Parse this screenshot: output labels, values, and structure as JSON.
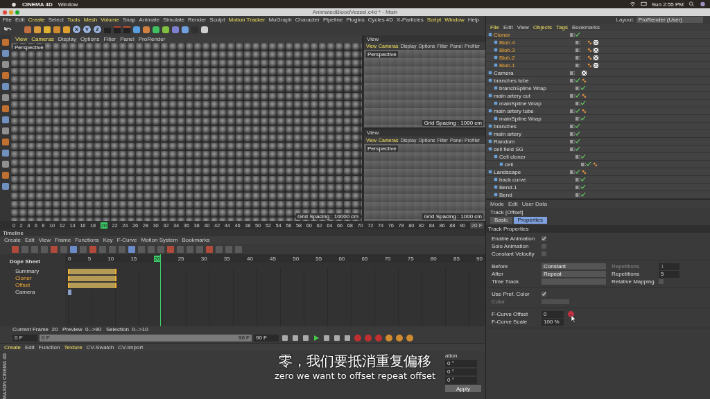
{
  "menubar": {
    "app": "CINEMA 4D",
    "menus": [
      "Window"
    ],
    "clock": "Sun 2:55 PM"
  },
  "window": {
    "title": "AnimatedBloodVessel.c4d * - Main"
  },
  "menu": [
    {
      "label": "File",
      "highlighted": false
    },
    {
      "label": "Edit",
      "highlighted": false
    },
    {
      "label": "Create",
      "highlighted": true
    },
    {
      "label": "Select",
      "highlighted": false
    },
    {
      "label": "Tools",
      "highlighted": true
    },
    {
      "label": "Mesh",
      "highlighted": true
    },
    {
      "label": "Volume",
      "highlighted": true
    },
    {
      "label": "Snap",
      "highlighted": false
    },
    {
      "label": "Animate",
      "highlighted": false
    },
    {
      "label": "Simulate",
      "highlighted": false
    },
    {
      "label": "Render",
      "highlighted": false
    },
    {
      "label": "Sculpt",
      "highlighted": false
    },
    {
      "label": "Motion Tracker",
      "highlighted": true
    },
    {
      "label": "MoGraph",
      "highlighted": false
    },
    {
      "label": "Character",
      "highlighted": false
    },
    {
      "label": "Pipeline",
      "highlighted": false
    },
    {
      "label": "Plugins",
      "highlighted": false
    },
    {
      "label": "Cycles 4D",
      "highlighted": false
    },
    {
      "label": "X-Particles",
      "highlighted": false
    },
    {
      "label": "Script",
      "highlighted": true
    },
    {
      "label": "Window",
      "highlighted": true
    },
    {
      "label": "Help",
      "highlighted": false
    }
  ],
  "layout": {
    "label": "Layout:",
    "value": "ProRender (User)"
  },
  "axis_buttons": [
    "X",
    "Y",
    "Z"
  ],
  "viewports": [
    {
      "menu": [
        {
          "label": "View",
          "highlighted": true
        },
        {
          "label": "Cameras",
          "highlighted": true
        },
        {
          "label": "Display",
          "highlighted": false
        },
        {
          "label": "Options",
          "highlighted": false
        },
        {
          "label": "Filter",
          "highlighted": false
        },
        {
          "label": "Panel",
          "highlighted": false
        },
        {
          "label": "ProRender",
          "highlighted": false
        }
      ],
      "camera": "Perspective",
      "grid": "Grid Spacing : 10000 cm"
    },
    {
      "header": "View",
      "menu": [
        {
          "label": "View",
          "highlighted": true
        },
        {
          "label": "Cameras",
          "highlighted": true
        },
        {
          "label": "Display",
          "highlighted": false
        },
        {
          "label": "Options",
          "highlighted": false
        },
        {
          "label": "Filter",
          "highlighted": false
        },
        {
          "label": "Panel",
          "highlighted": false
        },
        {
          "label": "Profiler",
          "highlighted": false
        }
      ],
      "camera": "Perspective",
      "grid": "Grid Spacing : 1000 cm"
    },
    {
      "header": "View",
      "menu": [
        {
          "label": "View",
          "highlighted": true
        },
        {
          "label": "Cameras",
          "highlighted": true
        },
        {
          "label": "Display",
          "highlighted": false
        },
        {
          "label": "Options",
          "highlighted": false
        },
        {
          "label": "Filter",
          "highlighted": false
        },
        {
          "label": "Panel",
          "highlighted": false
        },
        {
          "label": "Profiler",
          "highlighted": false
        }
      ],
      "camera": "Perspective",
      "grid": "Grid Spacing : 1000 cm"
    }
  ],
  "frame_ruler": {
    "ticks": [
      {
        "label": "0",
        "current": false
      },
      {
        "label": "2",
        "current": false
      },
      {
        "label": "4",
        "current": false
      },
      {
        "label": "6",
        "current": false
      },
      {
        "label": "8",
        "current": false
      },
      {
        "label": "10",
        "current": false
      },
      {
        "label": "12",
        "current": false
      },
      {
        "label": "14",
        "current": false
      },
      {
        "label": "16",
        "current": false
      },
      {
        "label": "18",
        "current": false
      },
      {
        "label": "20",
        "current": true
      },
      {
        "label": "22",
        "current": false
      },
      {
        "label": "24",
        "current": false
      },
      {
        "label": "26",
        "current": false
      },
      {
        "label": "28",
        "current": false
      },
      {
        "label": "30",
        "current": false
      },
      {
        "label": "32",
        "current": false
      },
      {
        "label": "34",
        "current": false
      },
      {
        "label": "36",
        "current": false
      },
      {
        "label": "38",
        "current": false
      },
      {
        "label": "40",
        "current": false
      },
      {
        "label": "42",
        "current": false
      },
      {
        "label": "44",
        "current": false
      },
      {
        "label": "46",
        "current": false
      },
      {
        "label": "48",
        "current": false
      },
      {
        "label": "50",
        "current": false
      },
      {
        "label": "52",
        "current": false
      },
      {
        "label": "54",
        "current": false
      },
      {
        "label": "56",
        "current": false
      },
      {
        "label": "58",
        "current": false
      },
      {
        "label": "60",
        "current": false
      },
      {
        "label": "62",
        "current": false
      },
      {
        "label": "64",
        "current": false
      },
      {
        "label": "66",
        "current": false
      },
      {
        "label": "68",
        "current": false
      },
      {
        "label": "70",
        "current": false
      },
      {
        "label": "72",
        "current": false
      },
      {
        "label": "74",
        "current": false
      },
      {
        "label": "76",
        "current": false
      },
      {
        "label": "78",
        "current": false
      },
      {
        "label": "80",
        "current": false
      },
      {
        "label": "82",
        "current": false
      },
      {
        "label": "84",
        "current": false
      },
      {
        "label": "86",
        "current": false
      },
      {
        "label": "88",
        "current": false
      },
      {
        "label": "90",
        "current": false
      }
    ],
    "end": "20 F"
  },
  "timeline": {
    "title": "Timeline",
    "menu": [
      "Create",
      "Edit",
      "View",
      "Frame",
      "Functions",
      "Key",
      "F-Curve",
      "Motion System",
      "Bookmarks"
    ],
    "mode": "Dope Sheet",
    "ticks": [
      {
        "label": "0",
        "current": false
      },
      {
        "label": "5",
        "current": false
      },
      {
        "label": "10",
        "current": false
      },
      {
        "label": "15",
        "current": false
      },
      {
        "label": "20",
        "current": true
      },
      {
        "label": "25",
        "current": false
      },
      {
        "label": "30",
        "current": false
      },
      {
        "label": "35",
        "current": false
      },
      {
        "label": "40",
        "current": false
      },
      {
        "label": "45",
        "current": false
      },
      {
        "label": "50",
        "current": false
      },
      {
        "label": "55",
        "current": false
      },
      {
        "label": "60",
        "current": false
      },
      {
        "label": "65",
        "current": false
      },
      {
        "label": "70",
        "current": false
      },
      {
        "label": "75",
        "current": false
      },
      {
        "label": "80",
        "current": false
      },
      {
        "label": "85",
        "current": false
      },
      {
        "label": "90",
        "current": false
      }
    ],
    "tracks": [
      {
        "name": "Summary",
        "selected": false,
        "kind": "range"
      },
      {
        "name": "Cloner",
        "selected": true,
        "kind": "range"
      },
      {
        "name": "Offset",
        "selected": true,
        "kind": "range"
      },
      {
        "name": "Camera",
        "selected": false,
        "kind": "single"
      }
    ],
    "status": "Current Frame  20   Preview  0-->90   Selection  0-->10",
    "start": "0 F",
    "slider": {
      "level": 1,
      "start": "0 F",
      "end": "90 F"
    },
    "end": "90 F"
  },
  "material_manager": {
    "menu": [
      {
        "label": "Create",
        "highlighted": true
      },
      {
        "label": "Edit",
        "highlighted": false
      },
      {
        "label": "Function",
        "highlighted": false
      },
      {
        "label": "Texture",
        "highlighted": true
      },
      {
        "label": "CV-Swatch",
        "highlighted": false
      },
      {
        "label": "CV-Import",
        "highlighted": false
      }
    ]
  },
  "coordinates": {
    "heading": "ation",
    "fields": [
      "0 °",
      "0 °",
      "0 °"
    ],
    "apply": "Apply"
  },
  "brand": "MAXON CINEMA 4D",
  "objects_menu": [
    {
      "label": "File",
      "highlighted": true
    },
    {
      "label": "Edit",
      "highlighted": false
    },
    {
      "label": "View",
      "highlighted": false
    },
    {
      "label": "Objects",
      "highlighted": true
    },
    {
      "label": "Tags",
      "highlighted": true
    },
    {
      "label": "Bookmarks",
      "highlighted": false
    }
  ],
  "objects": [
    {
      "name": "Cloner",
      "selected": true,
      "check": true,
      "children": [
        {
          "name": "Blob.4",
          "selected": true,
          "check": false,
          "tags": [
            {
              "kind": "phong"
            },
            {
              "kind": "texture"
            }
          ]
        },
        {
          "name": "Blob.3",
          "selected": true,
          "check": false,
          "tags": [
            {
              "kind": "phong"
            },
            {
              "kind": "texture"
            }
          ]
        },
        {
          "name": "Blob.2",
          "selected": true,
          "check": false,
          "tags": [
            {
              "kind": "phong"
            },
            {
              "kind": "texture"
            }
          ]
        },
        {
          "name": "Blob.1",
          "selected": true,
          "check": false,
          "tags": [
            {
              "kind": "phong"
            },
            {
              "kind": "texture"
            }
          ]
        }
      ]
    },
    {
      "name": "Camera",
      "selected": false,
      "check": false,
      "tags": [
        {
          "kind": "texture"
        }
      ]
    },
    {
      "name": "branches tube",
      "selected": false,
      "check": true,
      "tags": [
        {
          "kind": "phong"
        }
      ],
      "children": [
        {
          "name": "branchSpline Wrap",
          "selected": false,
          "check": true
        }
      ]
    },
    {
      "name": "main artery cut",
      "selected": false,
      "check": true,
      "tags": [
        {
          "kind": "phong"
        }
      ],
      "children": [
        {
          "name": "mainSpline Wrap",
          "selected": false,
          "check": true
        }
      ]
    },
    {
      "name": "main artery tube",
      "selected": false,
      "check": true,
      "tags": [
        {
          "kind": "phong"
        }
      ],
      "children": [
        {
          "name": "mainSpline Wrap",
          "selected": false,
          "check": true
        }
      ]
    },
    {
      "name": "branches",
      "selected": false,
      "check": true
    },
    {
      "name": "main artery",
      "selected": false,
      "check": true
    },
    {
      "name": "Random",
      "selected": false,
      "check": true
    },
    {
      "name": "cell field SG",
      "selected": false,
      "check": true,
      "children": [
        {
          "name": "Cell cloner",
          "selected": false,
          "check": true,
          "children": [
            {
              "name": "cell",
              "selected": false,
              "check": true,
              "tags": [
                {
                  "kind": "phong"
                }
              ]
            }
          ]
        }
      ]
    },
    {
      "name": "Landscape",
      "selected": false,
      "check": true,
      "tags": [
        {
          "kind": "phong"
        }
      ],
      "children": [
        {
          "name": "back curve",
          "selected": false,
          "check": true
        },
        {
          "name": "Bend.1",
          "selected": false,
          "check": true
        },
        {
          "name": "Bend",
          "selected": false,
          "check": true
        }
      ]
    }
  ],
  "attributes": {
    "menu": [
      "Mode",
      "Edit",
      "User Data"
    ],
    "title": "Track [Offset]",
    "tabs": [
      {
        "label": "Basic",
        "selected": false
      },
      {
        "label": "Properties",
        "selected": true
      }
    ],
    "section": "Track Properties",
    "groups": [
      [
        {
          "kind": "checkbox",
          "label": "Enable Animation",
          "checked": true
        },
        {
          "kind": "checkbox",
          "label": "Solo Animation",
          "checked": false
        },
        {
          "kind": "checkbox",
          "label": "Constant Velocity",
          "checked": false
        }
      ],
      [
        {
          "kind": "dropdown",
          "label": "Before",
          "value": "Constant",
          "side_label": "Repetitions",
          "side_value": "1",
          "side_disabled": true
        },
        {
          "kind": "dropdown",
          "label": "After",
          "value": "Repeat",
          "side_label": "Repetitions",
          "side_value": "5",
          "side_disabled": false
        },
        {
          "kind": "link",
          "label": "Time Track",
          "side_label": "Relative Mapping",
          "side_checked": false
        }
      ],
      [
        {
          "kind": "checkbox",
          "label": "Use Pref. Color",
          "checked": true
        },
        {
          "kind": "color",
          "label": "Color",
          "disabled": true
        }
      ],
      [
        {
          "kind": "field",
          "label": "F-Curve Offset",
          "value": "0"
        },
        {
          "kind": "field",
          "label": "F-Curve Scale",
          "value": "100 %"
        }
      ]
    ]
  },
  "subtitles": [
    "零，我们要抵消重复偏移",
    "zero we want to offset repeat offset"
  ]
}
